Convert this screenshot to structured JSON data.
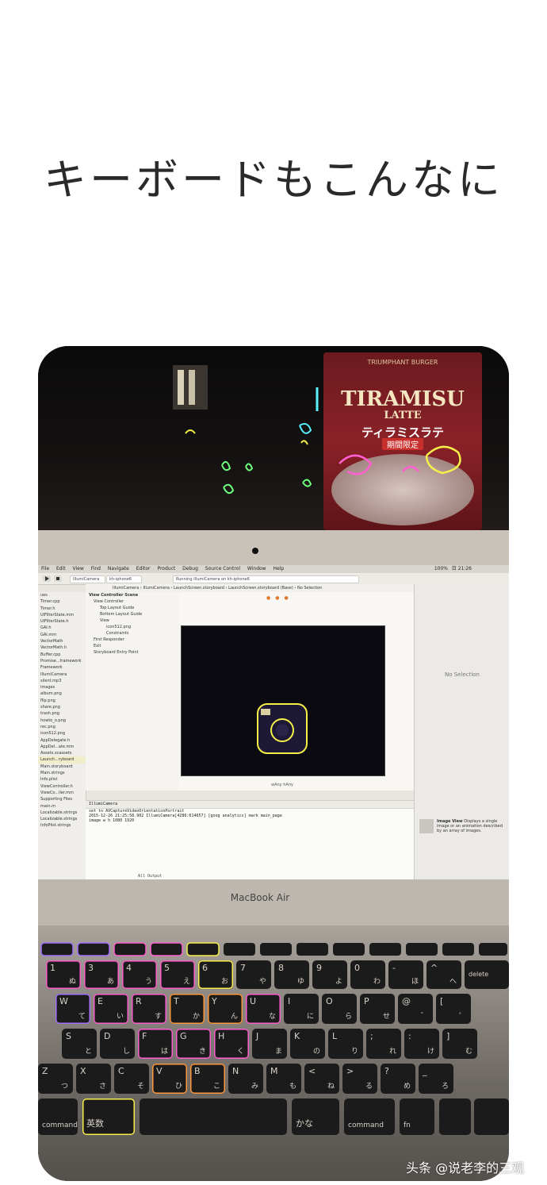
{
  "headline": "キーボードもこんなに",
  "poster": {
    "small": "TRIUMPHANT BURGER",
    "title1": "TIRAMISU",
    "title2": "LATTE",
    "title3": "ティラミスラテ",
    "badge": "期間限定"
  },
  "menubar": {
    "items": [
      "File",
      "Edit",
      "View",
      "Find",
      "Navigate",
      "Editor",
      "Product",
      "Debug",
      "Source Control",
      "Window",
      "Help"
    ],
    "clock": "日 21:26",
    "battery": "100%"
  },
  "toolbar": {
    "scheme": "IllumiCamera",
    "device": "kh-iphone6",
    "status": "Running IllumiCamera on kh-iphone6"
  },
  "pathbar": [
    "IllumiCamera",
    "IllumiCamera",
    "LaunchScreen.storyboard",
    "LaunchScreen.storyboard (Base)",
    "No Selection"
  ],
  "navigator": [
    "ues",
    "Timer.cpp",
    "Timer.h",
    "UIFilterState.mm",
    "UIFilterState.h",
    "GAI.h",
    "GAI.mm",
    "VectorMath",
    "VectorMath.h",
    "Buffer.cpp",
    "Promise...framework",
    "Framework",
    "IllumiCamera",
    "silent.mp3",
    "images",
    "album.png",
    "flip.png",
    "share.png",
    "trash.png",
    "howto_o.png",
    "rec.png",
    "icon512.png",
    "AppDelegate.h",
    "AppDel...ate.mm",
    "Assets.xcassets",
    "Launch...ryboard",
    "Main.storyboard",
    "Main.strings",
    "Info.plist",
    "ViewController.h",
    "ViewCo...ller.mm",
    "Supporting Files",
    "main.m",
    "Localizable.strings",
    "Localizable.strings",
    "InfoPlist.strings"
  ],
  "outline": [
    "View Controller Scene",
    "View Controller",
    "Top Layout Guide",
    "Bottom Layout Guide",
    "View",
    "icon512.png",
    "Constraints",
    "First Responder",
    "Exit",
    "Storyboard Entry Point"
  ],
  "canvas": {
    "size_label": "wAny hAny"
  },
  "inspector": {
    "no_selection": "No Selection",
    "library_item_title": "Image View",
    "library_item_desc": "Displays a single image or an animation described by an array of images."
  },
  "console": {
    "header": "IllumiCamera",
    "lines": [
      "set to AVCaptureVideoOrientationPortrait",
      "2015-12-26 21:25:58.902 IllumiCamera[4286:614657] [goog analytics] mark main_page",
      "image w h 1080 1920"
    ],
    "output_label": "All Output"
  },
  "brand": "MacBook Air",
  "keyboard": {
    "row1": [
      {
        "label": "1",
        "kana": "ぬ",
        "glow": "g-pink"
      },
      {
        "label": "3",
        "kana": "あ",
        "glow": "g-pink"
      },
      {
        "label": "4",
        "kana": "う",
        "glow": "g-pink"
      },
      {
        "label": "5",
        "kana": "え",
        "glow": "g-pink"
      },
      {
        "label": "6",
        "kana": "お",
        "glow": "g-yellow"
      },
      {
        "label": "7",
        "kana": "や",
        "glow": ""
      },
      {
        "label": "8",
        "kana": "ゆ",
        "glow": ""
      },
      {
        "label": "9",
        "kana": "よ",
        "glow": ""
      },
      {
        "label": "0",
        "kana": "わ",
        "glow": ""
      },
      {
        "label": "-",
        "kana": "ほ",
        "glow": ""
      },
      {
        "label": "^",
        "kana": "へ",
        "glow": ""
      },
      {
        "label": "delete",
        "kana": "",
        "glow": ""
      }
    ],
    "row2": [
      {
        "label": "W",
        "kana": "て",
        "glow": "g-purple"
      },
      {
        "label": "E",
        "kana": "い",
        "glow": "g-pink"
      },
      {
        "label": "R",
        "kana": "す",
        "glow": "g-pink"
      },
      {
        "label": "T",
        "kana": "か",
        "glow": "g-orange"
      },
      {
        "label": "Y",
        "kana": "ん",
        "glow": "g-orange"
      },
      {
        "label": "U",
        "kana": "な",
        "glow": "g-pink"
      },
      {
        "label": "I",
        "kana": "に",
        "glow": ""
      },
      {
        "label": "O",
        "kana": "ら",
        "glow": ""
      },
      {
        "label": "P",
        "kana": "せ",
        "glow": ""
      },
      {
        "label": "@",
        "kana": "゛",
        "glow": ""
      },
      {
        "label": "[",
        "kana": "゜",
        "glow": ""
      }
    ],
    "row3": [
      {
        "label": "S",
        "kana": "と",
        "glow": ""
      },
      {
        "label": "D",
        "kana": "し",
        "glow": ""
      },
      {
        "label": "F",
        "kana": "は",
        "glow": "g-pink"
      },
      {
        "label": "G",
        "kana": "き",
        "glow": "g-pink"
      },
      {
        "label": "H",
        "kana": "く",
        "glow": "g-pink"
      },
      {
        "label": "J",
        "kana": "ま",
        "glow": ""
      },
      {
        "label": "K",
        "kana": "の",
        "glow": ""
      },
      {
        "label": "L",
        "kana": "り",
        "glow": ""
      },
      {
        "label": ";",
        "kana": "れ",
        "glow": ""
      },
      {
        "label": ":",
        "kana": "け",
        "glow": ""
      },
      {
        "label": "]",
        "kana": "む",
        "glow": ""
      }
    ],
    "row4": [
      {
        "label": "Z",
        "kana": "つ",
        "glow": ""
      },
      {
        "label": "X",
        "kana": "さ",
        "glow": ""
      },
      {
        "label": "C",
        "kana": "そ",
        "glow": ""
      },
      {
        "label": "V",
        "kana": "ひ",
        "glow": "g-orange"
      },
      {
        "label": "B",
        "kana": "こ",
        "glow": "g-orange"
      },
      {
        "label": "N",
        "kana": "み",
        "glow": ""
      },
      {
        "label": "M",
        "kana": "も",
        "glow": ""
      },
      {
        "label": "<",
        "kana": "ね",
        "glow": ""
      },
      {
        "label": ">",
        "kana": "る",
        "glow": ""
      },
      {
        "label": "?",
        "kana": "め",
        "glow": ""
      },
      {
        "label": "_",
        "kana": "ろ",
        "glow": ""
      }
    ],
    "row5": {
      "command_left": "command",
      "eisu": "英数",
      "kana": "かな",
      "command_right": "command",
      "fn": "fn"
    }
  },
  "watermark": "头条 @说老李的三观",
  "colors": {
    "glow_pink": "#ff5fd2",
    "glow_purple": "#a272ff",
    "glow_orange": "#ff9a3c",
    "glow_yellow": "#f6ef4a",
    "glow_green": "#6eff7c",
    "glow_cyan": "#58f0ff"
  }
}
